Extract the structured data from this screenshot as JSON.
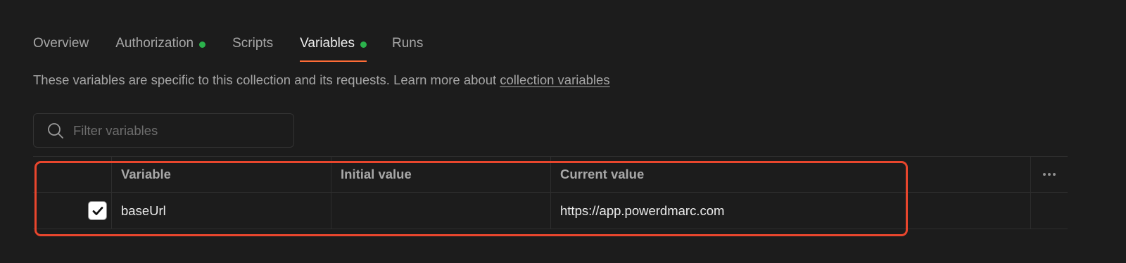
{
  "tabs": [
    {
      "label": "Overview",
      "active": false,
      "dot": false
    },
    {
      "label": "Authorization",
      "active": false,
      "dot": true
    },
    {
      "label": "Scripts",
      "active": false,
      "dot": false
    },
    {
      "label": "Variables",
      "active": true,
      "dot": true
    },
    {
      "label": "Runs",
      "active": false,
      "dot": false
    }
  ],
  "description": {
    "text": "These variables are specific to this collection and its requests. Learn more about ",
    "link_label": "collection variables"
  },
  "filter": {
    "placeholder": "Filter variables",
    "value": "",
    "icon": "search-icon"
  },
  "table": {
    "headers": {
      "variable": "Variable",
      "initial_value": "Initial value",
      "current_value": "Current value"
    },
    "rows": [
      {
        "enabled": true,
        "variable": "baseUrl",
        "initial_value": "",
        "current_value": "https://app.powerdmarc.com"
      }
    ],
    "more_icon": "more-horizontal-icon"
  },
  "colors": {
    "background": "#1c1c1c",
    "active_tab_underline": "#ff6c37",
    "status_dot": "#2bb24c",
    "highlight_border": "#e8462d"
  }
}
